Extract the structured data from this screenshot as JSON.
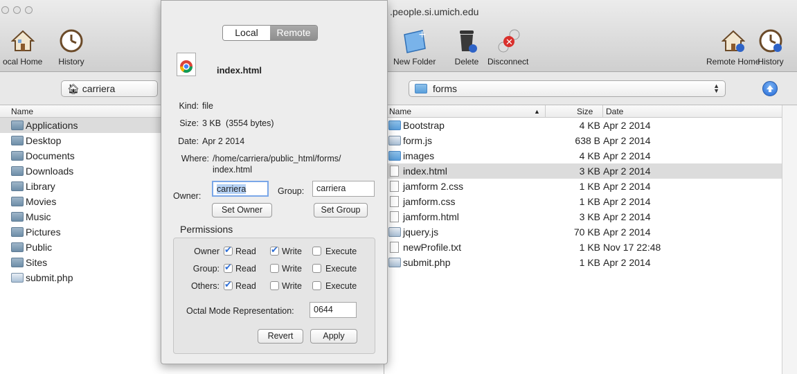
{
  "window": {
    "title": ".people.si.umich.edu"
  },
  "toolbar": {
    "local_home": "ocal Home",
    "history_left": "History",
    "new_folder": "New Folder",
    "delete": "Delete",
    "disconnect": "Disconnect",
    "remote_home": "Remote Home",
    "history_right": "History"
  },
  "left_path": "carriera",
  "right_path": "forms",
  "left_header": {
    "name": "Name"
  },
  "left_files": [
    {
      "name": "Applications",
      "icon": "folder-icon"
    },
    {
      "name": "Desktop",
      "icon": "folder-icon"
    },
    {
      "name": "Documents",
      "icon": "folder-icon"
    },
    {
      "name": "Downloads",
      "icon": "folder-icon"
    },
    {
      "name": "Library",
      "icon": "folder-icon"
    },
    {
      "name": "Movies",
      "icon": "folder-icon"
    },
    {
      "name": "Music",
      "icon": "folder-icon"
    },
    {
      "name": "Pictures",
      "icon": "folder-icon"
    },
    {
      "name": "Public",
      "icon": "folder-icon"
    },
    {
      "name": "Sites",
      "icon": "folder-icon"
    },
    {
      "name": "submit.php",
      "icon": "script-icon"
    }
  ],
  "right_header": {
    "name": "Name",
    "size": "Size",
    "date": "Date"
  },
  "right_files": [
    {
      "name": "Bootstrap",
      "size": "4 KB",
      "date": "Apr 2 2014"
    },
    {
      "name": "form.js",
      "size": "638 B",
      "date": "Apr 2 2014"
    },
    {
      "name": "images",
      "size": "4 KB",
      "date": "Apr 2 2014"
    },
    {
      "name": "index.html",
      "size": "3 KB",
      "date": "Apr 2 2014"
    },
    {
      "name": "jamform 2.css",
      "size": "1 KB",
      "date": "Apr 2 2014"
    },
    {
      "name": "jamform.css",
      "size": "1 KB",
      "date": "Apr 2 2014"
    },
    {
      "name": "jamform.html",
      "size": "3 KB",
      "date": "Apr 2 2014"
    },
    {
      "name": "jquery.js",
      "size": "70 KB",
      "date": "Apr 2 2014"
    },
    {
      "name": "newProfile.txt",
      "size": "1 KB",
      "date": "Nov 17 22:48"
    },
    {
      "name": "submit.php",
      "size": "1 KB",
      "date": "Apr 2 2014"
    }
  ],
  "info": {
    "seg_local": "Local",
    "seg_remote": "Remote",
    "filename": "index.html",
    "kind_label": "Kind:",
    "kind": "file",
    "size_label": "Size:",
    "size": "3 KB  (3554 bytes)",
    "date_label": "Date:",
    "date": "Apr 2 2014",
    "where_label": "Where:",
    "where1": "/home/carriera/public_html/forms/",
    "where2": "index.html",
    "owner_label": "Owner:",
    "owner": "carriera",
    "group_label": "Group:",
    "group": "carriera",
    "set_owner": "Set Owner",
    "set_group": "Set Group",
    "permissions": "Permissions",
    "row_owner": "Owner",
    "row_group": "Group:",
    "row_others": "Others:",
    "read": "Read",
    "write": "Write",
    "execute": "Execute",
    "octal_label": "Octal Mode Representation:",
    "octal": "0644",
    "revert": "Revert",
    "apply": "Apply"
  }
}
